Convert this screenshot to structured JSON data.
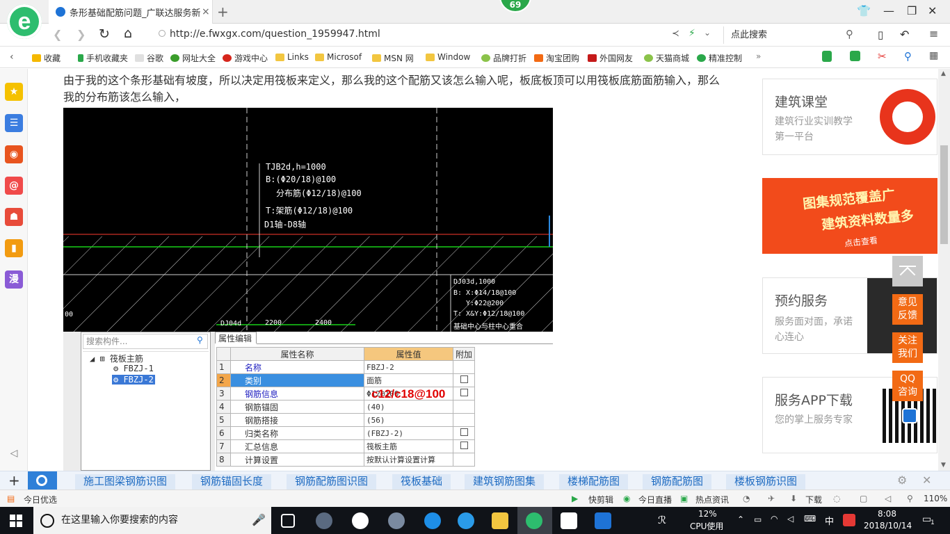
{
  "browser": {
    "tab_title": "条形基础配筋问题_广联达服务新",
    "close_glyph": "×",
    "new_tab_glyph": "+",
    "badge_count": "69",
    "url": "http://e.fwxgx.com/question_1959947.html",
    "search_placeholder": "点此搜索"
  },
  "bookmarks": [
    "收藏",
    "手机收藏夹",
    "谷歌",
    "网址大全",
    "游戏中心",
    "Links",
    "Microsof",
    "MSN 网",
    "Window",
    "品牌打折",
    "淘宝团购",
    "外国网友",
    "天猫商城",
    "精准控制"
  ],
  "dock": {
    "manhua_label": "漫"
  },
  "question": {
    "text": "由于我的这个条形基础有坡度，所以决定用筏板来定义，那么我的这个配筋又该怎么输入呢，板底板顶可以用筏板底筋面筋输入，那么我的分布筋该怎么输入，"
  },
  "cad": {
    "lines": [
      "TJB2d,h=1000",
      "B:(Φ20/18)@100",
      "分布筋(Φ12/18)@100",
      "T:架筋(Φ12/18)@100",
      "D1轴-D8轴"
    ],
    "lines2": [
      "DJ03d,1000",
      "B: X:Φ14/18@100",
      "Y:Φ22@200",
      "T: X&Y:Φ12/18@100",
      "基础中心与柱中心重合"
    ],
    "bottom_labels": [
      "DJ04d",
      "2200",
      "2400"
    ],
    "left_label": "00"
  },
  "software": {
    "search_placeholder": "搜索构件...",
    "tree": {
      "root": "筏板主筋",
      "children": [
        "FBZJ-1",
        "FBZJ-2"
      ]
    },
    "props_tab": "属性编辑",
    "headers": [
      "属性名称",
      "属性值",
      "附加"
    ],
    "rows": [
      {
        "idx": "1",
        "name": "名称",
        "value": "FBZJ-2"
      },
      {
        "idx": "2",
        "name": "类别",
        "value": "面筋"
      },
      {
        "idx": "3",
        "name": "钢筋信息",
        "value": "Φ12@100"
      },
      {
        "idx": "4",
        "name": "钢筋锚固",
        "value": "(40)"
      },
      {
        "idx": "5",
        "name": "钢筋搭接",
        "value": "(56)"
      },
      {
        "idx": "6",
        "name": "归类名称",
        "value": "(FBZJ-2)"
      },
      {
        "idx": "7",
        "name": "汇总信息",
        "value": "筏板主筋"
      },
      {
        "idx": "8",
        "name": "计算设置",
        "value": "按默认计算设置计算"
      }
    ],
    "overlay": "c12/c18@100"
  },
  "sidebar": {
    "card1_title": "建筑课堂",
    "card1_sub": "建筑行业实训教学第一平台",
    "promo_l1": "图集规范覆盖广",
    "promo_l2": "建筑资料数量多",
    "promo_l3": "点击查看",
    "card2_title": "预约服务",
    "card2_sub": "服务面对面，承诺心连心",
    "card3_title": "服务APP下载",
    "card3_sub": "您的掌上服务专家",
    "float_feedback": "意见反馈",
    "float_follow": "关注我们",
    "float_qq": "QQ咨询"
  },
  "linkbar": [
    "施工图梁钢筋识图",
    "钢筋锚固长度",
    "钢筋配筋图识图",
    "筏板基础",
    "建筑钢筋图集",
    "楼梯配筋图",
    "钢筋配筋图",
    "楼板钢筋识图"
  ],
  "statusbar": {
    "left": "今日优选",
    "items": [
      "快剪辑",
      "今日直播",
      "热点资讯",
      "下载"
    ],
    "zoom": "110%"
  },
  "taskbar": {
    "search": "在这里输入你要搜索的内容",
    "cpu_percent": "12%",
    "cpu_label": "CPU使用",
    "ime": "中",
    "time": "8:08",
    "date": "2018/10/14",
    "notif": "1"
  }
}
